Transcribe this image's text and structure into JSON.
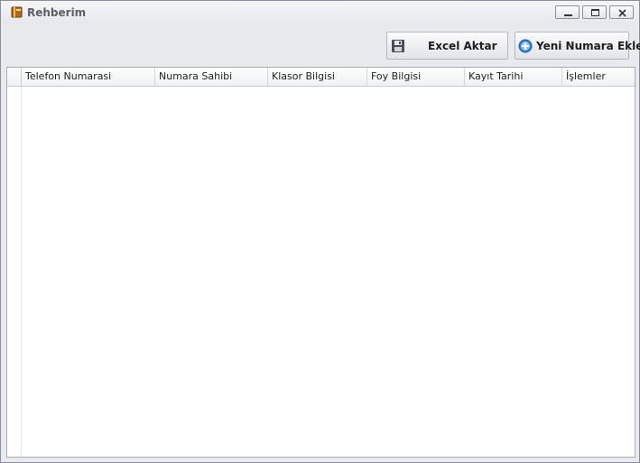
{
  "window": {
    "title": "Rehberim",
    "app_icon": "book-icon"
  },
  "window_controls": [
    "minimize-icon",
    "maximize-icon",
    "close-icon"
  ],
  "toolbar": {
    "excel_label": "Excel Aktar",
    "excel_icon": "floppy-disk-icon",
    "add_label": "Yeni Numara Ekle",
    "add_icon": "plus-circle-icon"
  },
  "grid": {
    "columns": [
      "Telefon Numarasi",
      "Numara Sahibi",
      "Klasor Bilgisi",
      "Foy Bilgisi",
      "Kayıt Tarihi",
      "İşlemler"
    ],
    "rows": []
  },
  "colors": {
    "window_bg": "#e9eaee",
    "border": "#8a8f98",
    "add_icon_blue": "#2f7fd2"
  }
}
